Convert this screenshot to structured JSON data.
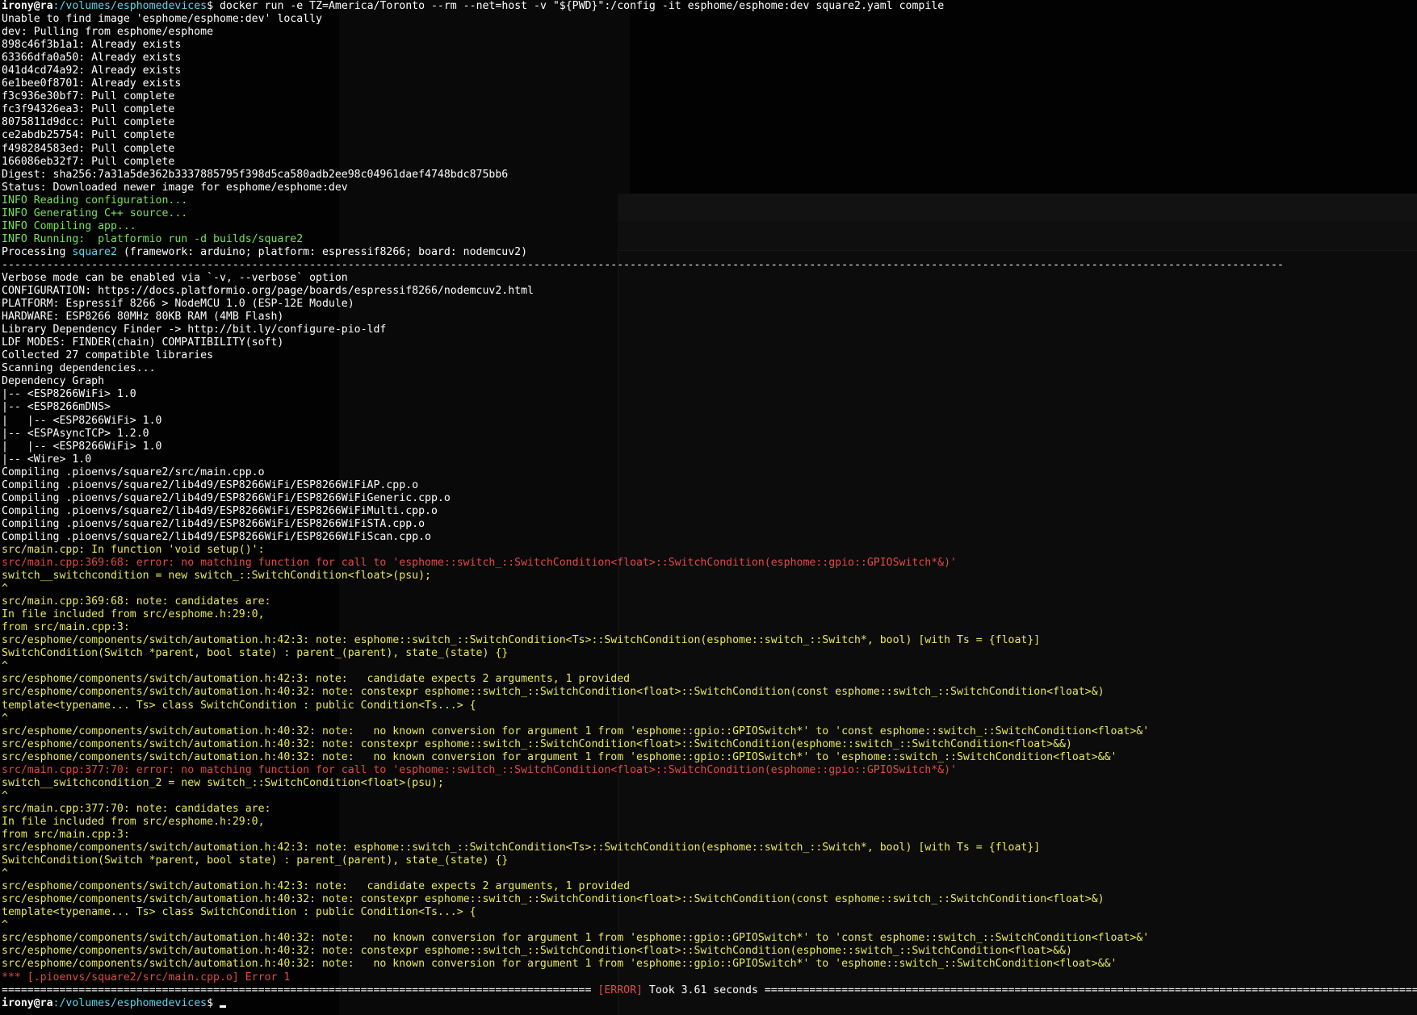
{
  "terminal": {
    "prompt": {
      "user": "irony@ra",
      "path": ":/volumes/esphomedevices",
      "dollar": "$ ",
      "command": "docker run -e TZ=America/Toronto --rm --net=host -v \"${PWD}\":/config -it esphome/esphome:dev square2.yaml compile"
    },
    "lines": [
      {
        "text": "Unable to find image 'esphome/esphome:dev' locally",
        "color": "white"
      },
      {
        "text": "dev: Pulling from esphome/esphome",
        "color": "white"
      },
      {
        "text": "898c46f3b1a1: Already exists",
        "color": "white"
      },
      {
        "text": "63366dfa0a50: Already exists",
        "color": "white"
      },
      {
        "text": "041d4cd74a92: Already exists",
        "color": "white"
      },
      {
        "text": "6e1bee0f8701: Already exists",
        "color": "white"
      },
      {
        "text": "f3c936e30bf7: Pull complete",
        "color": "white"
      },
      {
        "text": "fc3f94326ea3: Pull complete",
        "color": "white"
      },
      {
        "text": "8075811d9dcc: Pull complete",
        "color": "white"
      },
      {
        "text": "ce2abdb25754: Pull complete",
        "color": "white"
      },
      {
        "text": "f498284583ed: Pull complete",
        "color": "white"
      },
      {
        "text": "166086eb32f7: Pull complete",
        "color": "white"
      },
      {
        "text": "Digest: sha256:7a31a5de362b3337885795f398d5ca580adb2ee98c04961daef4748bdc875bb6",
        "color": "white"
      },
      {
        "text": "Status: Downloaded newer image for esphome/esphome:dev",
        "color": "white"
      },
      {
        "text": "INFO Reading configuration...",
        "color": "green"
      },
      {
        "text": "INFO Generating C++ source...",
        "color": "green"
      },
      {
        "text": "INFO Compiling app...",
        "color": "green"
      },
      {
        "text": "INFO Running:  platformio run -d builds/square2",
        "color": "green"
      },
      {
        "text": "Processing square2 (framework: arduino; platform: espressif8266; board: nodemcuv2)",
        "color": "white"
      },
      {
        "text": "--------------------------------------------------------------------------------------------------------------------------------------------------------------------------------------------------------",
        "color": "white"
      },
      {
        "text": "Verbose mode can be enabled via `-v, --verbose` option",
        "color": "white"
      },
      {
        "text": "CONFIGURATION: https://docs.platformio.org/page/boards/espressif8266/nodemcuv2.html",
        "color": "white"
      },
      {
        "text": "PLATFORM: Espressif 8266 > NodeMCU 1.0 (ESP-12E Module)",
        "color": "white"
      },
      {
        "text": "HARDWARE: ESP8266 80MHz 80KB RAM (4MB Flash)",
        "color": "white"
      },
      {
        "text": "Library Dependency Finder -> http://bit.ly/configure-pio-ldf",
        "color": "white"
      },
      {
        "text": "LDF MODES: FINDER(chain) COMPATIBILITY(soft)",
        "color": "white"
      },
      {
        "text": "Collected 27 compatible libraries",
        "color": "white"
      },
      {
        "text": "Scanning dependencies...",
        "color": "white"
      },
      {
        "text": "Dependency Graph",
        "color": "white"
      },
      {
        "text": "|-- <ESP8266WiFi> 1.0",
        "color": "white"
      },
      {
        "text": "|-- <ESP8266mDNS>",
        "color": "white"
      },
      {
        "text": "|   |-- <ESP8266WiFi> 1.0",
        "color": "white"
      },
      {
        "text": "|-- <ESPAsyncTCP> 1.2.0",
        "color": "white"
      },
      {
        "text": "|   |-- <ESP8266WiFi> 1.0",
        "color": "white"
      },
      {
        "text": "|-- <Wire> 1.0",
        "color": "white"
      },
      {
        "text": "Compiling .pioenvs/square2/src/main.cpp.o",
        "color": "white"
      },
      {
        "text": "Compiling .pioenvs/square2/lib4d9/ESP8266WiFi/ESP8266WiFiAP.cpp.o",
        "color": "white"
      },
      {
        "text": "Compiling .pioenvs/square2/lib4d9/ESP8266WiFi/ESP8266WiFiGeneric.cpp.o",
        "color": "white"
      },
      {
        "text": "Compiling .pioenvs/square2/lib4d9/ESP8266WiFi/ESP8266WiFiMulti.cpp.o",
        "color": "white"
      },
      {
        "text": "Compiling .pioenvs/square2/lib4d9/ESP8266WiFi/ESP8266WiFiSTA.cpp.o",
        "color": "white"
      },
      {
        "text": "Compiling .pioenvs/square2/lib4d9/ESP8266WiFi/ESP8266WiFiScan.cpp.o",
        "color": "white"
      },
      {
        "text": "src/main.cpp: In function 'void setup()':",
        "color": "yellow"
      },
      {
        "text": "src/main.cpp:369:68: error: no matching function for call to 'esphome::switch_::SwitchCondition<float>::SwitchCondition(esphome::gpio::GPIOSwitch*&)'",
        "color": "red"
      },
      {
        "text": "switch__switchcondition = new switch_::SwitchCondition<float>(psu);",
        "color": "yellow"
      },
      {
        "text": "^",
        "color": "yellow"
      },
      {
        "text": "src/main.cpp:369:68: note: candidates are:",
        "color": "yellow"
      },
      {
        "text": "In file included from src/esphome.h:29:0,",
        "color": "yellow"
      },
      {
        "text": "from src/main.cpp:3:",
        "color": "yellow"
      },
      {
        "text": "src/esphome/components/switch/automation.h:42:3: note: esphome::switch_::SwitchCondition<Ts>::SwitchCondition(esphome::switch_::Switch*, bool) [with Ts = {float}]",
        "color": "yellow"
      },
      {
        "text": "SwitchCondition(Switch *parent, bool state) : parent_(parent), state_(state) {}",
        "color": "yellow"
      },
      {
        "text": "^",
        "color": "yellow"
      },
      {
        "text": "src/esphome/components/switch/automation.h:42:3: note:   candidate expects 2 arguments, 1 provided",
        "color": "yellow"
      },
      {
        "text": "src/esphome/components/switch/automation.h:40:32: note: constexpr esphome::switch_::SwitchCondition<float>::SwitchCondition(const esphome::switch_::SwitchCondition<float>&)",
        "color": "yellow"
      },
      {
        "text": "template<typename... Ts> class SwitchCondition : public Condition<Ts...> {",
        "color": "yellow"
      },
      {
        "text": "^",
        "color": "yellow"
      },
      {
        "text": "src/esphome/components/switch/automation.h:40:32: note:   no known conversion for argument 1 from 'esphome::gpio::GPIOSwitch*' to 'const esphome::switch_::SwitchCondition<float>&'",
        "color": "yellow"
      },
      {
        "text": "src/esphome/components/switch/automation.h:40:32: note: constexpr esphome::switch_::SwitchCondition<float>::SwitchCondition(esphome::switch_::SwitchCondition<float>&&)",
        "color": "yellow"
      },
      {
        "text": "src/esphome/components/switch/automation.h:40:32: note:   no known conversion for argument 1 from 'esphome::gpio::GPIOSwitch*' to 'esphome::switch_::SwitchCondition<float>&&'",
        "color": "yellow"
      },
      {
        "text": "src/main.cpp:377:70: error: no matching function for call to 'esphome::switch_::SwitchCondition<float>::SwitchCondition(esphome::gpio::GPIOSwitch*&)'",
        "color": "red"
      },
      {
        "text": "switch__switchcondition_2 = new switch_::SwitchCondition<float>(psu);",
        "color": "yellow"
      },
      {
        "text": "^",
        "color": "yellow"
      },
      {
        "text": "src/main.cpp:377:70: note: candidates are:",
        "color": "yellow"
      },
      {
        "text": "In file included from src/esphome.h:29:0,",
        "color": "yellow"
      },
      {
        "text": "from src/main.cpp:3:",
        "color": "yellow"
      },
      {
        "text": "src/esphome/components/switch/automation.h:42:3: note: esphome::switch_::SwitchCondition<Ts>::SwitchCondition(esphome::switch_::Switch*, bool) [with Ts = {float}]",
        "color": "yellow"
      },
      {
        "text": "SwitchCondition(Switch *parent, bool state) : parent_(parent), state_(state) {}",
        "color": "yellow"
      },
      {
        "text": "^",
        "color": "yellow"
      },
      {
        "text": "src/esphome/components/switch/automation.h:42:3: note:   candidate expects 2 arguments, 1 provided",
        "color": "yellow"
      },
      {
        "text": "src/esphome/components/switch/automation.h:40:32: note: constexpr esphome::switch_::SwitchCondition<float>::SwitchCondition(const esphome::switch_::SwitchCondition<float>&)",
        "color": "yellow"
      },
      {
        "text": "template<typename... Ts> class SwitchCondition : public Condition<Ts...> {",
        "color": "yellow"
      },
      {
        "text": "^",
        "color": "yellow"
      },
      {
        "text": "src/esphome/components/switch/automation.h:40:32: note:   no known conversion for argument 1 from 'esphome::gpio::GPIOSwitch*' to 'const esphome::switch_::SwitchCondition<float>&'",
        "color": "yellow"
      },
      {
        "text": "src/esphome/components/switch/automation.h:40:32: note: constexpr esphome::switch_::SwitchCondition<float>::SwitchCondition(esphome::switch_::SwitchCondition<float>&&)",
        "color": "yellow"
      },
      {
        "text": "src/esphome/components/switch/automation.h:40:32: note:   no known conversion for argument 1 from 'esphome::gpio::GPIOSwitch*' to 'esphome::switch_::SwitchCondition<float>&&'",
        "color": "yellow"
      },
      {
        "text": "*** [.pioenvs/square2/src/main.cpp.o] Error 1",
        "color": "red"
      }
    ],
    "summary": {
      "dashes_left": "============================================================================================",
      "error_tag": "[ERROR]",
      "took": " Took 3.61 seconds ",
      "dashes_right": "=========================================================================================================================="
    },
    "final_prompt": {
      "user": "irony@ra",
      "path": ":/volumes/esphomedevices",
      "dollar": "$ "
    },
    "colors": {
      "background": "#020202",
      "white": "#ffffff",
      "green": "#78e05a",
      "yellow": "#e8e85a",
      "red": "#e04848",
      "cyan": "#5ad7e8"
    }
  }
}
